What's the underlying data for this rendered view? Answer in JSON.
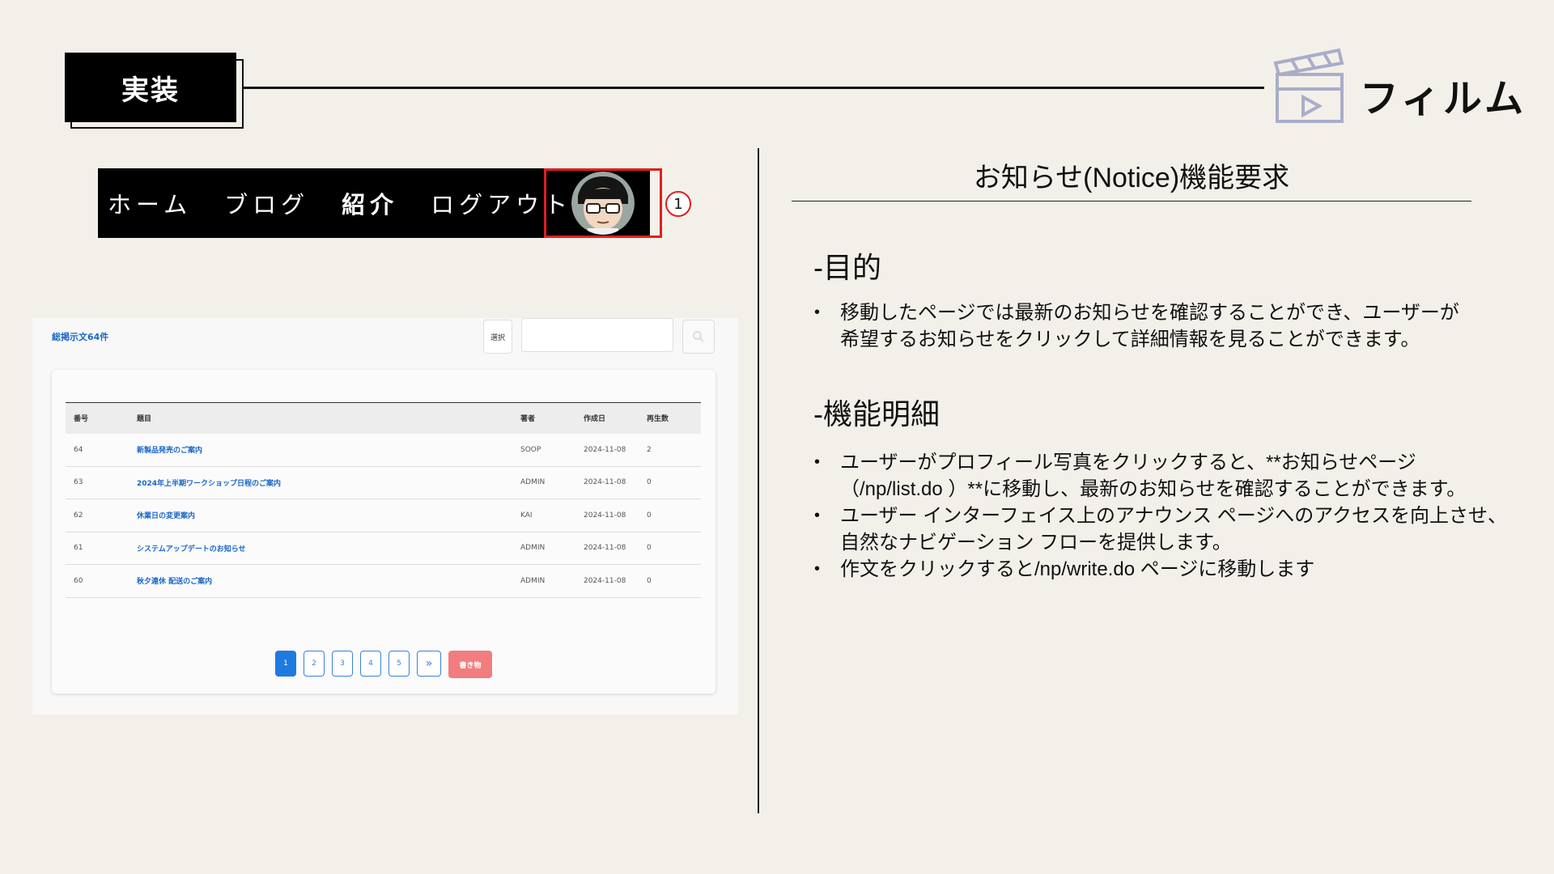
{
  "header": {
    "section_tag": "実装",
    "project_name": "フィルム",
    "project_icon": "clapperboard-icon"
  },
  "navbar": {
    "items": [
      "ホーム",
      "ブログ",
      "紹介",
      "ログアウト"
    ],
    "marker": "1"
  },
  "notice_list": {
    "total_label": "総掲示文64件",
    "select_label": "選択",
    "search_placeholder": "",
    "columns": [
      "番号",
      "題目",
      "著者",
      "作成日",
      "再生数"
    ],
    "rows": [
      [
        "64",
        "新製品発売のご案内",
        "SOOP",
        "2024-11-08",
        "2"
      ],
      [
        "63",
        "2024年上半期ワークショップ日程のご案内",
        "ADMIN",
        "2024-11-08",
        "0"
      ],
      [
        "62",
        "休業日の変更案内",
        "KAI",
        "2024-11-08",
        "0"
      ],
      [
        "61",
        "システムアップデートのお知らせ",
        "ADMIN",
        "2024-11-08",
        "0"
      ],
      [
        "60",
        "秋夕連休 配送のご案内",
        "ADMIN",
        "2024-11-08",
        "0"
      ]
    ],
    "pages": [
      "1",
      "2",
      "3",
      "4",
      "5"
    ],
    "next_label": "»",
    "write_label": "書き物",
    "colors": {
      "link": "#1b66c9",
      "active_page": "#1f7ae0",
      "write_button": "#f17d80"
    }
  },
  "requirements": {
    "title": "お知らせ(Notice)機能要求",
    "purpose_heading": "-目的",
    "purpose_items": [
      "移動したページでは最新のお知らせを確認することができ、ユーザーが希望するお知らせをクリックして詳細情報を見ることができます。"
    ],
    "detail_heading": "-機能明細",
    "detail_items": [
      "ユーザーがプロフィール写真をクリックすると、**お知らせページ（/np/list.do ）**に移動し、最新のお知らせを確認することができます。",
      "ユーザー インターフェイス上のアナウンス ページへのアクセスを向上させ、自然なナビゲーション フローを提供します。",
      "作文をクリックすると/np/write.do ページに移動します"
    ]
  }
}
